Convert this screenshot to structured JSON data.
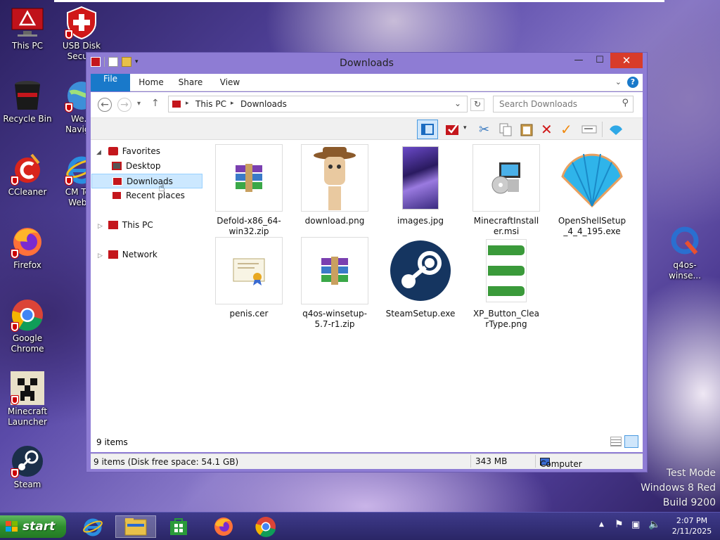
{
  "desktop": {
    "icons": [
      {
        "label": "This PC"
      },
      {
        "label": "USB Disk Secu..."
      },
      {
        "label": "Recycle Bin"
      },
      {
        "label": "We... Navig..."
      },
      {
        "label": "CCleaner"
      },
      {
        "label": "CM To... Web..."
      },
      {
        "label": "Firefox"
      },
      {
        "label": "Google Chrome"
      },
      {
        "label": "Minecraft Launcher"
      },
      {
        "label": "Steam"
      },
      {
        "label": "q4os-winse..."
      }
    ],
    "watermark": [
      "Test Mode",
      "Windows 8 Red",
      "Build 9200"
    ]
  },
  "window": {
    "title": "Downloads",
    "ribbon_tabs": [
      "File",
      "Home",
      "Share",
      "View"
    ],
    "breadcrumb": [
      "This PC",
      "Downloads"
    ],
    "search_placeholder": "Search Downloads",
    "nav": {
      "favorites": "Favorites",
      "desktop": "Desktop",
      "downloads": "Downloads",
      "recent": "Recent places",
      "thispc": "This PC",
      "network": "Network"
    },
    "files": [
      {
        "name": "Defold-x86_64-win32.zip",
        "icon": "winrar-archive-icon"
      },
      {
        "name": "download.png",
        "icon": "image-thumbnail-character"
      },
      {
        "name": "images.jpg",
        "icon": "image-thumbnail-purple-collage"
      },
      {
        "name": "MinecraftInstaller.msi",
        "icon": "msi-installer-icon"
      },
      {
        "name": "OpenShellSetup_4_4_195.exe",
        "icon": "shell-icon"
      },
      {
        "name": "penis.cer",
        "icon": "certificate-icon"
      },
      {
        "name": "q4os-winsetup-5.7-r1.zip",
        "icon": "winrar-archive-icon"
      },
      {
        "name": "SteamSetup.exe",
        "icon": "steam-icon"
      },
      {
        "name": "XP_Button_ClearType.png",
        "icon": "xp-start-buttons-thumbnail"
      }
    ],
    "item_count": "9 items",
    "status": {
      "left": "9 items (Disk free space: 54.1 GB)",
      "size": "343 MB",
      "location": "Computer"
    }
  },
  "taskbar": {
    "start_label": "start",
    "time": "2:07 PM",
    "date": "2/11/2025"
  },
  "colors": {
    "accent": "#1979ca",
    "window_frame": "#8e7cd4",
    "close": "#d83c2a"
  }
}
